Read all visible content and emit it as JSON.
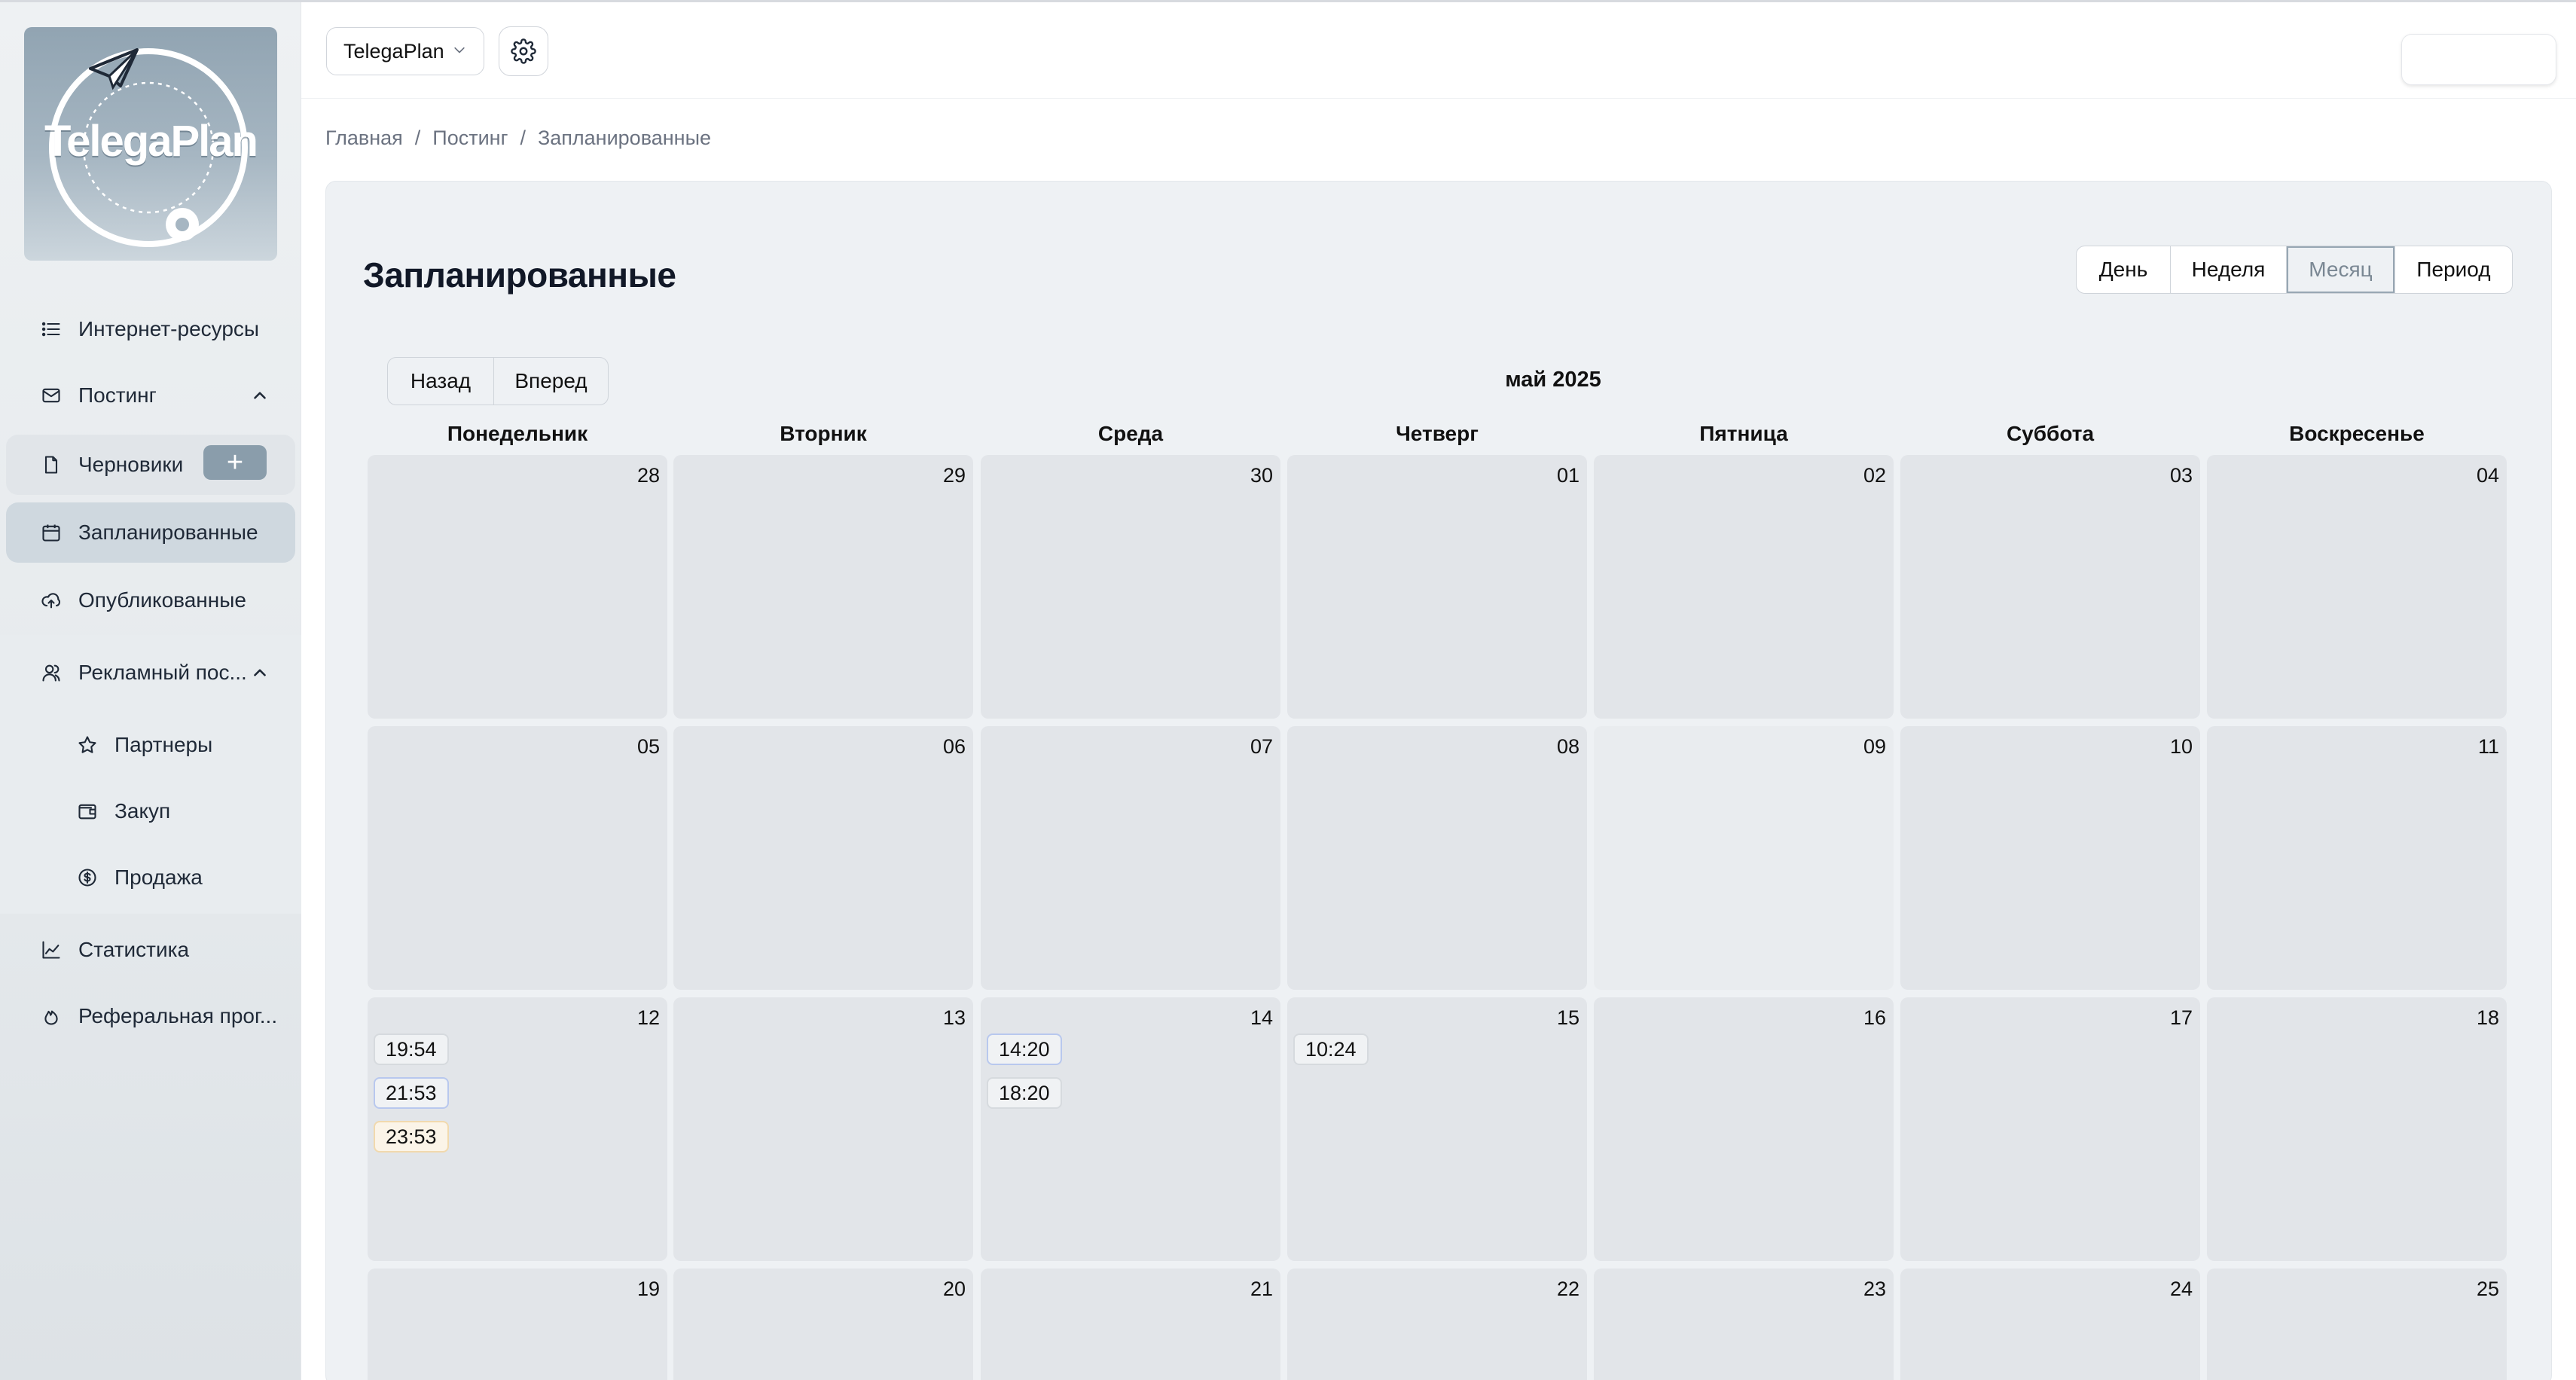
{
  "app": {
    "logo_text": "TelegaPlan",
    "project": "TelegaPlan"
  },
  "sidebar": {
    "internet": "Интернет-ресурсы",
    "posting": "Постинг",
    "drafts": "Черновики",
    "scheduled": "Запланированные",
    "published": "Опубликованные",
    "ads": "Рекламный пос...",
    "partners": "Партнеры",
    "purchase": "Закуп",
    "sale": "Продажа",
    "stats": "Статистика",
    "referral": "Реферальная прог..."
  },
  "breadcrumb": {
    "home": "Главная",
    "posting": "Постинг",
    "current": "Запланированные",
    "sep": "/"
  },
  "page": {
    "title": "Запланированные"
  },
  "views": {
    "day": "День",
    "week": "Неделя",
    "month": "Месяц",
    "period": "Период",
    "active": "month"
  },
  "calnav": {
    "back": "Назад",
    "forward": "Вперед"
  },
  "calendar": {
    "month_label": "май 2025",
    "weekdays": [
      "Понедельник",
      "Вторник",
      "Среда",
      "Четверг",
      "Пятница",
      "Суббота",
      "Воскресенье"
    ],
    "weeks": [
      [
        "28",
        "29",
        "30",
        "01",
        "02",
        "03",
        "04"
      ],
      [
        "05",
        "06",
        "07",
        "08",
        "09",
        "10",
        "11"
      ],
      [
        "12",
        "13",
        "14",
        "15",
        "16",
        "17",
        "18"
      ],
      [
        "19",
        "20",
        "21",
        "22",
        "23",
        "24",
        "25"
      ]
    ],
    "events": [
      {
        "week": 2,
        "day": 0,
        "times": [
          "19:54",
          "21:53",
          "23:53"
        ],
        "styles": [
          "gray",
          "blue",
          "orange"
        ]
      },
      {
        "week": 2,
        "day": 2,
        "times": [
          "14:20",
          "18:20"
        ],
        "styles": [
          "blue",
          "gray"
        ]
      },
      {
        "week": 2,
        "day": 3,
        "times": [
          "10:24"
        ],
        "styles": [
          "gray"
        ]
      }
    ]
  },
  "colors": {
    "accent": "#8a9dab",
    "active_nav": "#cfd8df",
    "cell": "#e2e5e9",
    "event_blue": "#b8c8ee",
    "event_orange": "#f1d9ae"
  }
}
